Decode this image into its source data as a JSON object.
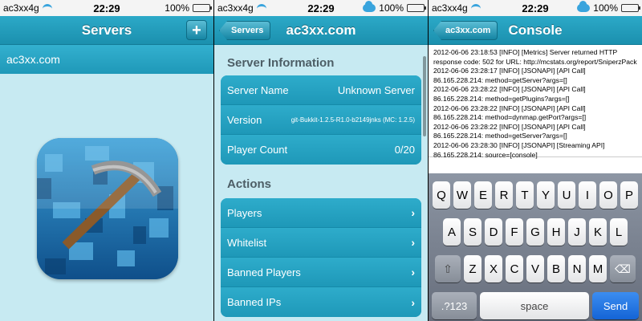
{
  "status": {
    "carrier": "ac3xx4g",
    "time": "22:29",
    "battery": "100%",
    "battery_level": 1.0
  },
  "panel1": {
    "nav_title": "Servers",
    "add_label": "+",
    "server_item": "ac3xx.com"
  },
  "panel2": {
    "back_label": "Servers",
    "nav_title": "ac3xx.com",
    "info_section": "Server Information",
    "info": [
      {
        "label": "Server Name",
        "value": "Unknown Server"
      },
      {
        "label": "Version",
        "value": "git-Bukkit-1.2.5-R1.0-b2149jnks (MC: 1.2.5)"
      },
      {
        "label": "Player Count",
        "value": "0/20"
      }
    ],
    "actions_section": "Actions",
    "actions": [
      "Players",
      "Whitelist",
      "Banned Players",
      "Banned IPs"
    ],
    "chevron": "›"
  },
  "panel3": {
    "back_label": "ac3xx.com",
    "nav_title": "Console",
    "log": [
      "2012-06-06 23:18:53 [INFO] [Metrics] Server returned HTTP response code: 502 for URL: http://mcstats.org/report/SniperzPack",
      "2012-06-06 23:28:17 [INFO] [JSONAPI] [API Call] 86.165.228.214: method=getServer?args=[]",
      "2012-06-06 23:28:22 [INFO] [JSONAPI] [API Call] 86.165.228.214: method=getPlugins?args=[]",
      "2012-06-06 23:28:22 [INFO] [JSONAPI] [API Call] 86.165.228.214: method=dynmap.getPort?args=[]",
      "2012-06-06 23:28:22 [INFO] [JSONAPI] [API Call] 86.165.228.214: method=getServer?args=[]",
      "2012-06-06 23:28:30 [INFO] [JSONAPI] [Streaming API] 86.165.228.214: source=[console]"
    ],
    "keyboard": {
      "row1": [
        "Q",
        "W",
        "E",
        "R",
        "T",
        "Y",
        "U",
        "I",
        "O",
        "P"
      ],
      "row2": [
        "A",
        "S",
        "D",
        "F",
        "G",
        "H",
        "J",
        "K",
        "L"
      ],
      "row3": [
        "Z",
        "X",
        "C",
        "V",
        "B",
        "N",
        "M"
      ],
      "shift": "⇧",
      "backspace": "⌫",
      "numbers": ".?123",
      "space": "space",
      "send": "Send"
    }
  }
}
